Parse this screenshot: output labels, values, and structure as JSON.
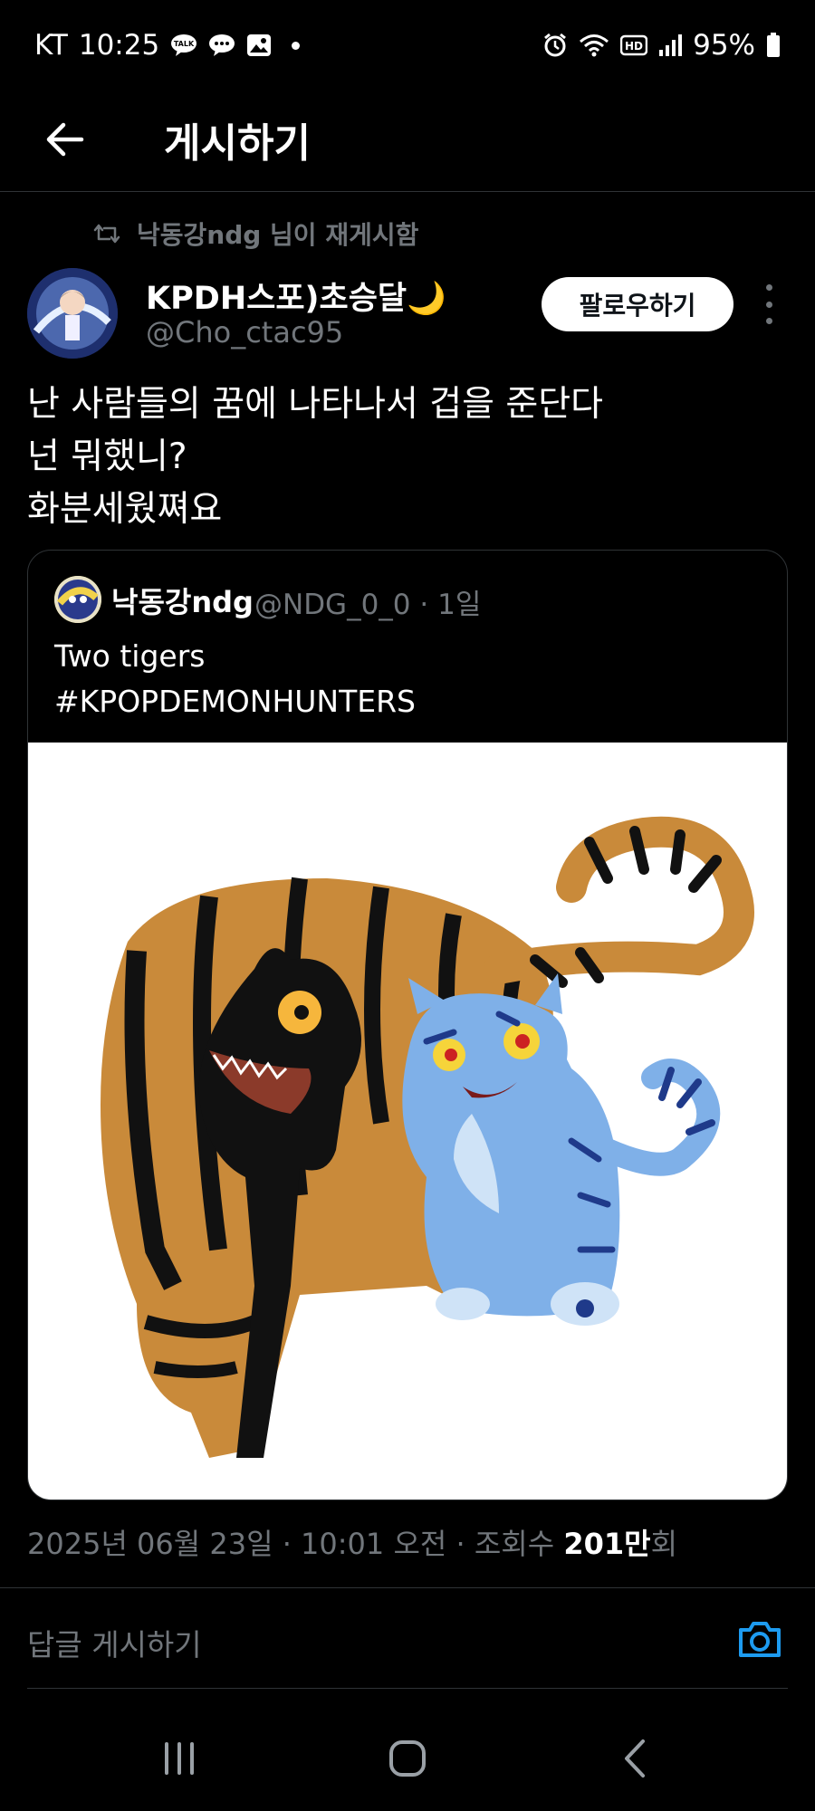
{
  "status_bar": {
    "carrier": "KT",
    "time": "10:25",
    "battery": "95%",
    "icons": [
      "talk-icon",
      "chat-icon",
      "gallery-icon",
      "alarm-icon",
      "wifi-icon",
      "hd-icon",
      "signal-icon",
      "battery-icon"
    ]
  },
  "header": {
    "title": "게시하기",
    "back_icon": "back-arrow-icon"
  },
  "tweet": {
    "repost_label": "낙동강ndg 님이 재게시함",
    "author_name": "KPDH스포)초승달🌙",
    "author_handle": "@Cho_ctac95",
    "follow_label": "팔로우하기",
    "body_lines": [
      "난 사람들의 꿈에 나타나서 겁을 준단다",
      "넌 뭐했니?",
      "화분세웠쪄요"
    ],
    "quote": {
      "author_name": "낙동강ndg",
      "meta": "@NDG_0_0 · 1일",
      "text_lines": [
        "Two tigers",
        "#KPOPDEMONHUNTERS"
      ]
    },
    "meta": {
      "date_time": "2025년 06월 23일 · 10:01 오전 · 조회수",
      "views_number": "201만",
      "views_suffix": "회"
    }
  },
  "reply": {
    "placeholder": "답글 게시하기"
  },
  "nav": {
    "icons": [
      "recent-apps-icon",
      "home-icon",
      "back-icon"
    ]
  },
  "colors": {
    "background": "#000000",
    "text": "#e7e9ea",
    "secondary": "#71767b",
    "divider": "#2f3336",
    "accent": "#1d9bf0"
  }
}
